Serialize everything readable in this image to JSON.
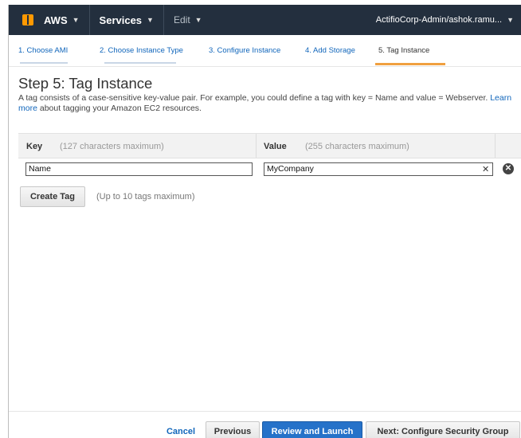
{
  "nav": {
    "brand": "AWS",
    "services": "Services",
    "edit": "Edit",
    "account": "ActifioCorp-Admin/ashok.ramu..."
  },
  "steps": [
    {
      "label": "1. Choose AMI"
    },
    {
      "label": "2. Choose Instance Type"
    },
    {
      "label": "3. Configure Instance"
    },
    {
      "label": "4. Add Storage"
    },
    {
      "label": "5. Tag Instance"
    }
  ],
  "page": {
    "title": "Step 5: Tag Instance",
    "desc_pre": "A tag consists of a case-sensitive key-value pair. For example, you could define a tag with key = Name and value = Webserver.",
    "learn_more": "Learn more",
    "desc_post": "about tagging your Amazon EC2 resources."
  },
  "table": {
    "key_header": "Key",
    "key_hint": "(127 characters maximum)",
    "value_header": "Value",
    "value_hint": "(255 characters maximum)",
    "row": {
      "key": "Name",
      "value": "MyCompany"
    }
  },
  "create": {
    "label": "Create Tag",
    "hint": "(Up to 10 tags maximum)"
  },
  "footer": {
    "cancel": "Cancel",
    "previous": "Previous",
    "review": "Review and Launch",
    "next": "Next: Configure Security Group"
  },
  "colors": {
    "nav_bg": "#232f3e",
    "accent_orange": "#f90",
    "link_blue": "#1166bb",
    "primary_button": "#2672c9"
  }
}
